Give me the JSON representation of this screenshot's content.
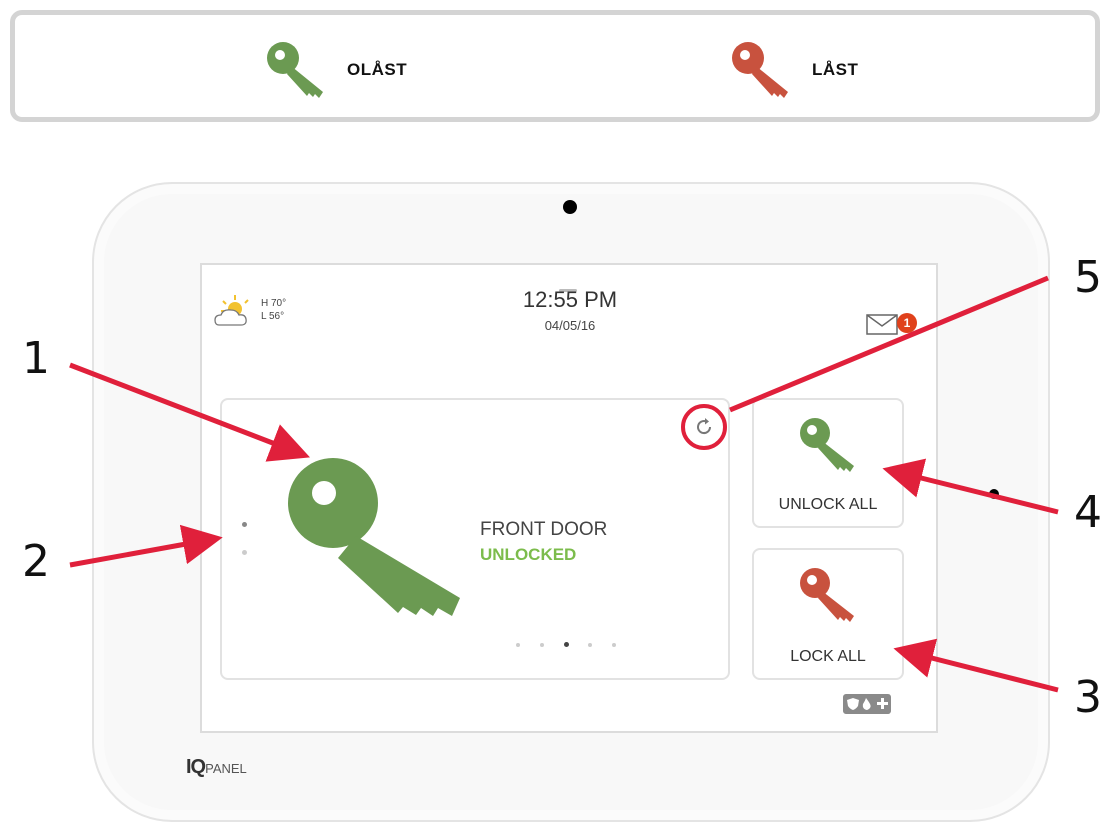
{
  "legend": {
    "unlocked_label": "OLÅST",
    "locked_label": "LÅST"
  },
  "weather": {
    "high": "H 70°",
    "low": "L 56°"
  },
  "clock": {
    "time": "12:55 PM",
    "date": "04/05/16"
  },
  "notifications": {
    "count": "1"
  },
  "lock": {
    "name": "FRONT DOOR",
    "status": "UNLOCKED"
  },
  "actions": {
    "unlock_all": "UNLOCK ALL",
    "lock_all": "LOCK ALL"
  },
  "pager": {
    "pages": 5,
    "active_index": 2
  },
  "brand": {
    "prefix": "IQ",
    "suffix": "PANEL"
  },
  "callouts": [
    "1",
    "2",
    "3",
    "4",
    "5"
  ],
  "colors": {
    "unlocked_key": "#6b9a52",
    "locked_key": "#c8523e",
    "status_green": "#7cbc4c",
    "callout_red": "#e0203b",
    "badge": "#e0411b"
  }
}
